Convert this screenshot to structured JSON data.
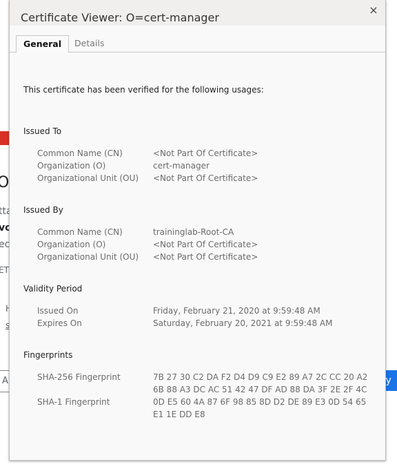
{
  "background": {
    "title_fragment": "O",
    "line_fragments": [
      "tta",
      "vo",
      "ec",
      "ET:",
      "H",
      "s"
    ],
    "input_fragment": "A",
    "button_fragment": "ty",
    "colors": {
      "warning": "#d93025",
      "primary_button": "#1a73e8"
    }
  },
  "dialog": {
    "title": "Certificate Viewer: O=cert-manager",
    "close_icon": "×",
    "tabs": [
      {
        "label": "General",
        "active": true
      },
      {
        "label": "Details",
        "active": false
      }
    ],
    "usage_text": "This certificate has been verified for the following usages:",
    "sections": {
      "issued_to": {
        "title": "Issued To",
        "rows": [
          {
            "label": "Common Name (CN)",
            "value": "<Not Part Of Certificate>"
          },
          {
            "label": "Organization (O)",
            "value": "cert-manager"
          },
          {
            "label": "Organizational Unit (OU)",
            "value": "<Not Part Of Certificate>"
          }
        ]
      },
      "issued_by": {
        "title": "Issued By",
        "rows": [
          {
            "label": "Common Name (CN)",
            "value": "traininglab-Root-CA"
          },
          {
            "label": "Organization (O)",
            "value": "<Not Part Of Certificate>"
          },
          {
            "label": "Organizational Unit (OU)",
            "value": "<Not Part Of Certificate>"
          }
        ]
      },
      "validity": {
        "title": "Validity Period",
        "rows": [
          {
            "label": "Issued On",
            "value": "Friday, February 21, 2020 at 9:59:48 AM"
          },
          {
            "label": "Expires On",
            "value": "Saturday, February 20, 2021 at 9:59:48 AM"
          }
        ]
      },
      "fingerprints": {
        "title": "Fingerprints",
        "sha256_label": "SHA-256 Fingerprint",
        "sha256_value": "7B 27 30 C2 DA F2 D4 D9 C9 E2 89 A7 2C CC 20 A2 6B 88 A3 DC AC 51 42 47 DF AD 88 DA 3F 2E 2F 4C",
        "sha1_label": "SHA-1 Fingerprint",
        "sha1_value": "0D E5 60 4A 87 6F 98 85 8D D2 DE 89 E3 0D 54 65 E1 1E DD E8"
      }
    }
  }
}
